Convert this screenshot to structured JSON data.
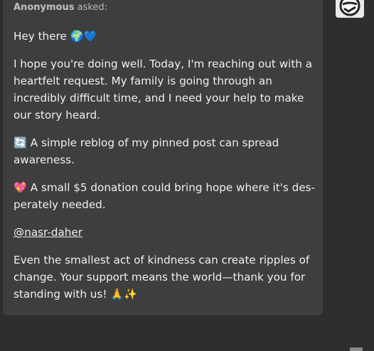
{
  "ask": {
    "asker_name": "Anonymous",
    "asked_suffix": " asked:",
    "greeting": "Hey there 🌍💙",
    "paragraph_1": "I hope you're doing well. Today, I'm reaching out with a heartfelt request. My family is going through an incredibly difficult time, and I need your help to make our story heard.",
    "paragraph_2": "🔄 A simple reblog of my pinned post can spread awareness.",
    "paragraph_3": "💖 A small $5 donation could bring hope where it's des­perately needed.",
    "mention": "@nasr-daher",
    "paragraph_4": "Even the smallest act of kindness can create ripples of change. Your support means the world—thank you for standing with us! 🙏✨"
  },
  "avatar": {
    "icon": "asker-avatar-icon"
  },
  "colors": {
    "page_background": "#2e2e2e",
    "card_background": "#3e3e3e",
    "text": "#f0f0f0"
  }
}
